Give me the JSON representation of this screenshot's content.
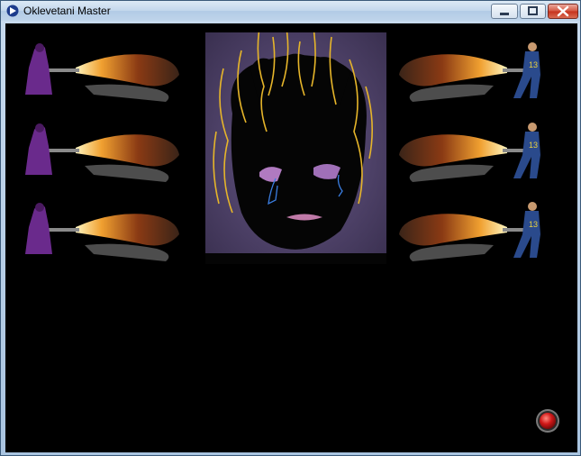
{
  "window": {
    "title": "Oklevetani Master",
    "icons": {
      "app": "app-icon",
      "minimize": "minimize-icon",
      "maximize": "maximize-icon",
      "close": "close-icon"
    }
  },
  "colors": {
    "client_background": "#000000",
    "titlebar": "#c3d7ec",
    "hair_lines": "#e6b52a",
    "tear_lines": "#3a7de0",
    "stop_button": "#d01818"
  },
  "scene": {
    "left_figures": [
      {
        "character": "purple-robed-flamethrower-figure"
      },
      {
        "character": "purple-robed-flamethrower-figure"
      },
      {
        "character": "purple-robed-flamethrower-figure"
      }
    ],
    "right_figures": [
      {
        "character": "vault-suit-flamethrower-figure",
        "jersey_number": "13"
      },
      {
        "character": "vault-suit-flamethrower-figure",
        "jersey_number": "13"
      },
      {
        "character": "vault-suit-flamethrower-figure",
        "jersey_number": "13"
      }
    ],
    "center": {
      "image": "defaced-portrait"
    },
    "stop_button_icon": "red-record-button-icon"
  }
}
